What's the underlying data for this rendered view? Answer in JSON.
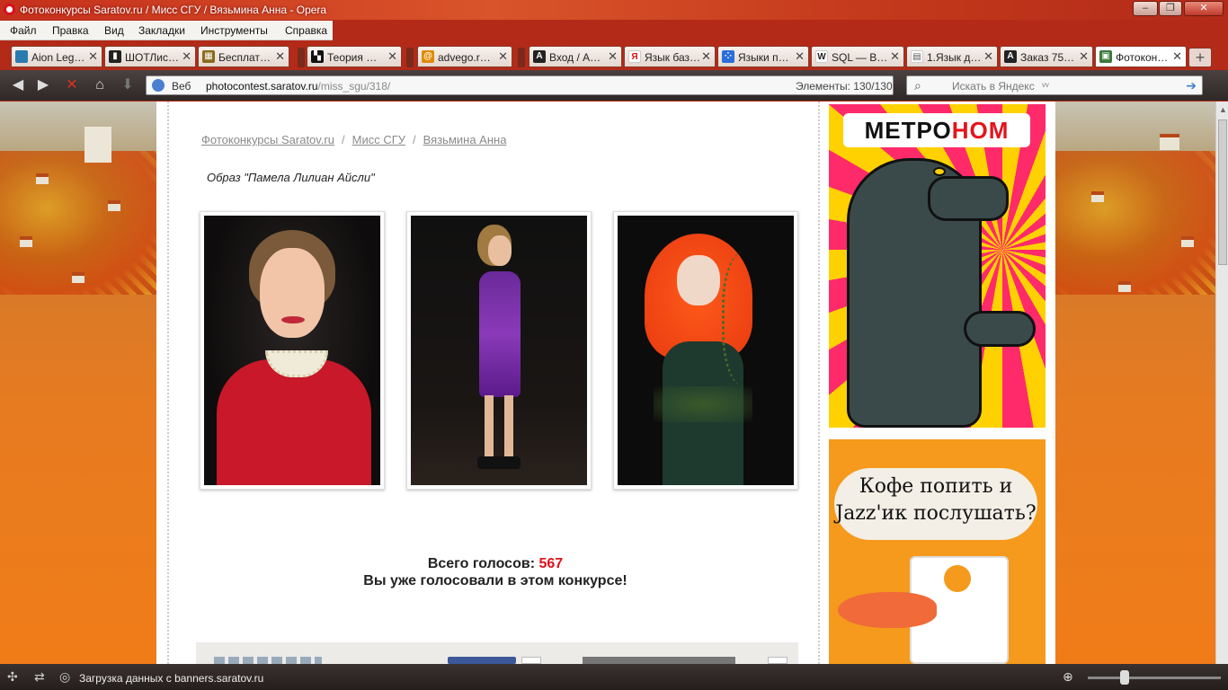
{
  "window": {
    "title": "Фотоконкурсы Saratov.ru / Мисс СГУ / Вязьмина Анна - Opera",
    "minimize": "–",
    "maximize": "❐",
    "close": "✕"
  },
  "menu": [
    "Файл",
    "Правка",
    "Вид",
    "Закладки",
    "Инструменты",
    "Справка"
  ],
  "tabs": [
    {
      "label": "Aion Leg…",
      "icon": "aion-icon",
      "color": "#2a7ab0"
    },
    {
      "label": "ШОТЛис…",
      "icon": "chart-icon",
      "color": "#222"
    },
    {
      "label": "Бесплат…",
      "icon": "grid-icon",
      "color": "#8a6b1a"
    },
    {
      "label": "Теория …",
      "icon": "clapper-icon",
      "color": "#111"
    },
    {
      "label": "advego.r…",
      "icon": "at-icon",
      "color": "#e08a00"
    },
    {
      "label": "Вход / А…",
      "icon": "a-icon",
      "color": "#222"
    },
    {
      "label": "Язык баз…",
      "icon": "yandex-icon",
      "color": "#e01010"
    },
    {
      "label": "Языки п…",
      "icon": "dots-icon",
      "color": "#2a6fd8"
    },
    {
      "label": "SQL — В…",
      "icon": "wikipedia-icon",
      "color": "#444"
    },
    {
      "label": "1.Язык д…",
      "icon": "doc-icon",
      "color": "#555"
    },
    {
      "label": "Заказ 75…",
      "icon": "a-icon",
      "color": "#222"
    },
    {
      "label": "Фотокон…",
      "icon": "photo-icon",
      "color": "#3a7a3a"
    }
  ],
  "address": {
    "mode": "Веб",
    "host": "photocontest.saratov.ru",
    "path": "/miss_sgu/318/",
    "elements_label": "Элементы:",
    "elements_value": "130/130"
  },
  "search": {
    "placeholder": "Искать в Яндекс",
    "extra": "ᵛᵛ"
  },
  "breadcrumb": {
    "home": "Фотоконкурсы Saratov.ru",
    "section": "Мисс СГУ",
    "current": "Вязьмина Анна",
    "separator": "/"
  },
  "caption": "Образ \"Памела Лилиан Айсли\"",
  "votes": {
    "label": "Всего голосов:",
    "count": "567"
  },
  "voted_message": "Вы уже голосовали в этом конкурсе!",
  "banners": {
    "metronom": {
      "logo_a": "МЕТРО",
      "logo_b": "НОМ"
    },
    "coffee": {
      "text": "Кофе попить и Jazz'ик послушать?"
    }
  },
  "status": {
    "text": "Загрузка данных с banners.saratov.ru"
  },
  "colors": {
    "accent": "#e0101a",
    "frame": "#c5301c"
  }
}
